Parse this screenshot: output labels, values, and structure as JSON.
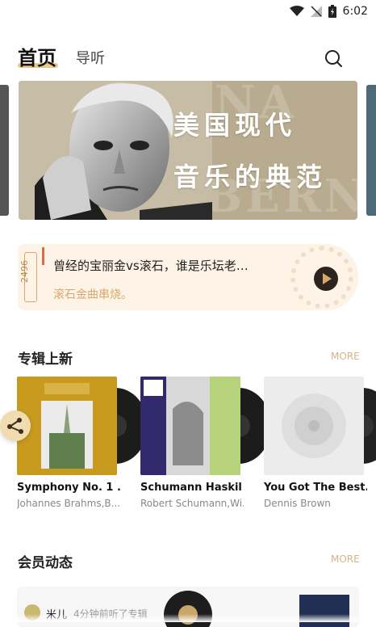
{
  "status_bar": {
    "time": "6:02"
  },
  "header": {
    "tab_home": "首页",
    "tab_guide": "导听",
    "search_icon": "search-icon"
  },
  "banner": {
    "line1": "美国现代",
    "line2": "音乐的典范",
    "bg_text_1": "ONA",
    "bg_text_2": "BERN"
  },
  "radio": {
    "frequency": "2496",
    "title": "曾经的宝丽金vs滚石，谁是乐坛老…",
    "subtitle": "滚石金曲串烧。"
  },
  "new_albums": {
    "title": "专辑上新",
    "more": "MORE",
    "items": [
      {
        "title": "Symphony No. 1 ...",
        "artist": "Johannes Brahms,B..."
      },
      {
        "title": "Schumann Haskil",
        "artist": "Robert Schumann,Wi..."
      },
      {
        "title": "You Got The Best...",
        "artist": "Dennis Brown"
      }
    ]
  },
  "member_activity": {
    "title": "会员动态",
    "more": "MORE",
    "item": {
      "name": "米儿",
      "action": "4分钟前听了专辑"
    }
  },
  "colors": {
    "accent": "#e8b96a",
    "more": "#d4b48a",
    "radio_bg": "#fdf3e6"
  }
}
